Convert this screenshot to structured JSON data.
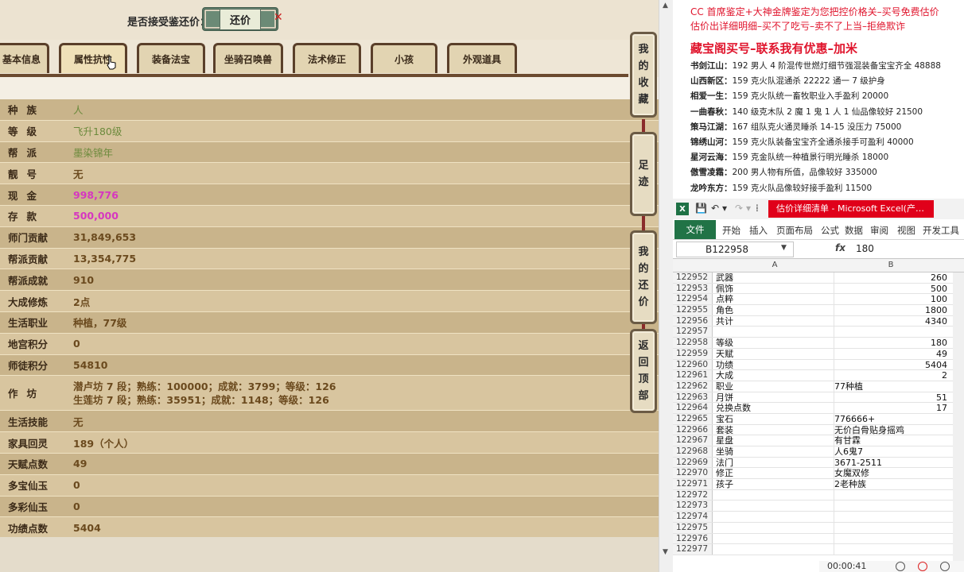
{
  "offer": {
    "question": "是否接受鉴还价：",
    "button": "还价"
  },
  "tabs": [
    "基本信息",
    "属性抗性",
    "装备法宝",
    "坐骑召唤兽",
    "法术修正",
    "小孩",
    "外观道具"
  ],
  "side_nav": [
    {
      "label": [
        "我",
        "的",
        "收",
        "藏"
      ]
    },
    {
      "label": [
        "足",
        "迹"
      ]
    },
    {
      "label": [
        "我",
        "的",
        "还",
        "价"
      ]
    },
    {
      "label": [
        "返",
        "回",
        "顶",
        "部"
      ]
    }
  ],
  "attributes": [
    {
      "label": "种族",
      "value": "人",
      "style": "green"
    },
    {
      "label": "等级",
      "value": "飞升180级",
      "style": "green"
    },
    {
      "label": "帮派",
      "value": "墨染锦年",
      "style": "green"
    },
    {
      "label": "靓号",
      "value": "无",
      "style": "brown"
    },
    {
      "label": "现金",
      "value": "998,776",
      "style": "pink"
    },
    {
      "label": "存款",
      "value": "500,000",
      "style": "pink"
    },
    {
      "label": "师门贡献",
      "value": "31,849,653",
      "style": "brown"
    },
    {
      "label": "帮派贡献",
      "value": "13,354,775",
      "style": "brown"
    },
    {
      "label": "帮派成就",
      "value": "910",
      "style": "brown"
    },
    {
      "label": "大成修炼",
      "value": "2点",
      "style": "brown"
    },
    {
      "label": "生活职业",
      "value": "种植，77级",
      "style": "brown"
    },
    {
      "label": "地宫积分",
      "value": "0",
      "style": "brown"
    },
    {
      "label": "师徒积分",
      "value": "54810",
      "style": "brown"
    },
    {
      "label": "作坊",
      "lines": [
        "潜卢坊 7 段；熟练：100000；成就：3799；等级：126",
        "生莲坊 7 段；熟练：35951；成就：1148；等级：126"
      ]
    },
    {
      "label": "生活技能",
      "value": "无",
      "style": "brown"
    },
    {
      "label": "家具回灵",
      "value": "189（个人）",
      "style": "brown"
    },
    {
      "label": "天赋点数",
      "value": "49",
      "style": "brown"
    },
    {
      "label": "多宝仙玉",
      "value": "0",
      "style": "brown"
    },
    {
      "label": "多彩仙玉",
      "value": "0",
      "style": "brown"
    },
    {
      "label": "功绩点数",
      "value": "5404",
      "style": "brown"
    }
  ],
  "ads": {
    "top_lines": [
      "CC 首席鉴定+大神金牌鉴定为您把控价格关–买号免费估价",
      "估价出详细明细–买不了吃亏–卖不了上当–拒绝欺诈"
    ],
    "headline": "藏宝阁买号–联系我有优惠–加米",
    "listings": [
      {
        "name": "书剑江山：",
        "desc": "192 男人 4 阶混传世燃灯细节强混装备宝宝齐全 48888"
      },
      {
        "name": "山西新区：",
        "desc": "159 克火队混通杀 22222 通一 7 级护身"
      },
      {
        "name": "相爱一生：",
        "desc": "159 克火队统一畜牧职业入手盈利 20000"
      },
      {
        "name": "一曲春秋：",
        "desc": "140 级克木队 2 魔 1 鬼 1 人 1 仙品像较好 21500"
      },
      {
        "name": "策马江湖：",
        "desc": "167 组队克火通灵睡杀 14-15 没压力 75000"
      },
      {
        "name": "锦绣山河：",
        "desc": "159 克火队装备宝宝齐全通杀接手可盈利 40000"
      },
      {
        "name": "星河云海：",
        "desc": "159 克金队统一种植景行明光睡杀 18000"
      },
      {
        "name": "傲雪凌霜：",
        "desc": "200 男人物有所值，品像较好 335000"
      },
      {
        "name": "龙吟东方：",
        "desc": "159 克火队品像较好接手盈利 11500"
      }
    ]
  },
  "excel": {
    "caption": "估价详细清单 - Microsoft Excel(产…",
    "ribbon_file": "文件",
    "ribbon_tabs": [
      "开始",
      "插入",
      "页面布局",
      "公式",
      "数据",
      "审阅",
      "视图",
      "开发工具"
    ],
    "name_box": "B122958",
    "fx": "fx",
    "formula": "180",
    "col_a": "A",
    "col_b": "B",
    "rows": [
      {
        "n": "122952",
        "a": "武器",
        "b": "260",
        "num": true
      },
      {
        "n": "122953",
        "a": "佩饰",
        "b": "500",
        "num": true
      },
      {
        "n": "122954",
        "a": "点粹",
        "b": "100",
        "num": true
      },
      {
        "n": "122955",
        "a": "角色",
        "b": "1800",
        "num": true
      },
      {
        "n": "122956",
        "a": "共计",
        "b": "4340",
        "num": true
      },
      {
        "n": "122957",
        "a": "",
        "b": "",
        "num": true
      },
      {
        "n": "122958",
        "a": "等级",
        "b": "180",
        "num": true
      },
      {
        "n": "122959",
        "a": "天赋",
        "b": "49",
        "num": true
      },
      {
        "n": "122960",
        "a": "功绩",
        "b": "5404",
        "num": true
      },
      {
        "n": "122961",
        "a": "大成",
        "b": "2",
        "num": true
      },
      {
        "n": "122962",
        "a": "职业",
        "b": "77种植",
        "num": false
      },
      {
        "n": "122963",
        "a": "月饼",
        "b": "51",
        "num": true
      },
      {
        "n": "122964",
        "a": "兑换点数",
        "b": "17",
        "num": true
      },
      {
        "n": "122965",
        "a": "宝石",
        "b": "776666+",
        "num": false
      },
      {
        "n": "122966",
        "a": "套装",
        "b": "无价白骨贴身摇鸡",
        "num": false
      },
      {
        "n": "122967",
        "a": "星盘",
        "b": "有甘霖",
        "num": false
      },
      {
        "n": "122968",
        "a": "坐骑",
        "b": "人6鬼7",
        "num": false
      },
      {
        "n": "122969",
        "a": "法门",
        "b": "3671-2511",
        "num": false
      },
      {
        "n": "122970",
        "a": "修正",
        "b": "女魔双修",
        "num": false
      },
      {
        "n": "122971",
        "a": "孩子",
        "b": "2老种族",
        "num": false
      },
      {
        "n": "122972",
        "a": "",
        "b": "",
        "num": false
      },
      {
        "n": "122973",
        "a": "",
        "b": "",
        "num": false
      },
      {
        "n": "122974",
        "a": "",
        "b": "",
        "num": false
      },
      {
        "n": "122975",
        "a": "",
        "b": "",
        "num": false
      },
      {
        "n": "122976",
        "a": "",
        "b": "",
        "num": false
      },
      {
        "n": "122977",
        "a": "",
        "b": "",
        "num": false
      }
    ]
  },
  "recorder": {
    "time": "00:00:41"
  }
}
